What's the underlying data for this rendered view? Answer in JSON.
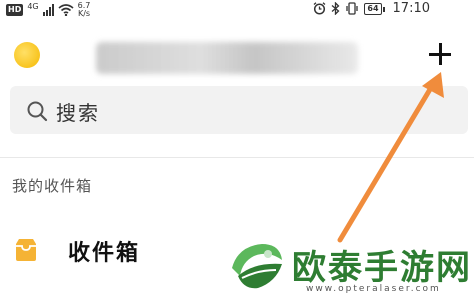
{
  "status_bar": {
    "hd": "HD",
    "network": "4G",
    "speed_value": "6.7",
    "speed_unit": "K/s",
    "battery": "64",
    "time": "17:10",
    "icons": [
      "alarm-icon",
      "bluetooth-icon",
      "vibrate-icon",
      "battery-icon"
    ]
  },
  "header": {
    "add_icon": "plus-icon"
  },
  "search": {
    "placeholder": "搜索"
  },
  "section": {
    "title": "我的收件箱"
  },
  "inbox": {
    "label": "收件箱",
    "icon": "inbox-tray-icon",
    "icon_color": "#f5b335"
  },
  "annotation": {
    "arrow_color": "#f08c3c"
  },
  "watermark": {
    "title": "欧泰手游网",
    "url": "www.opteralaser.com",
    "color": "#2e7d32"
  }
}
